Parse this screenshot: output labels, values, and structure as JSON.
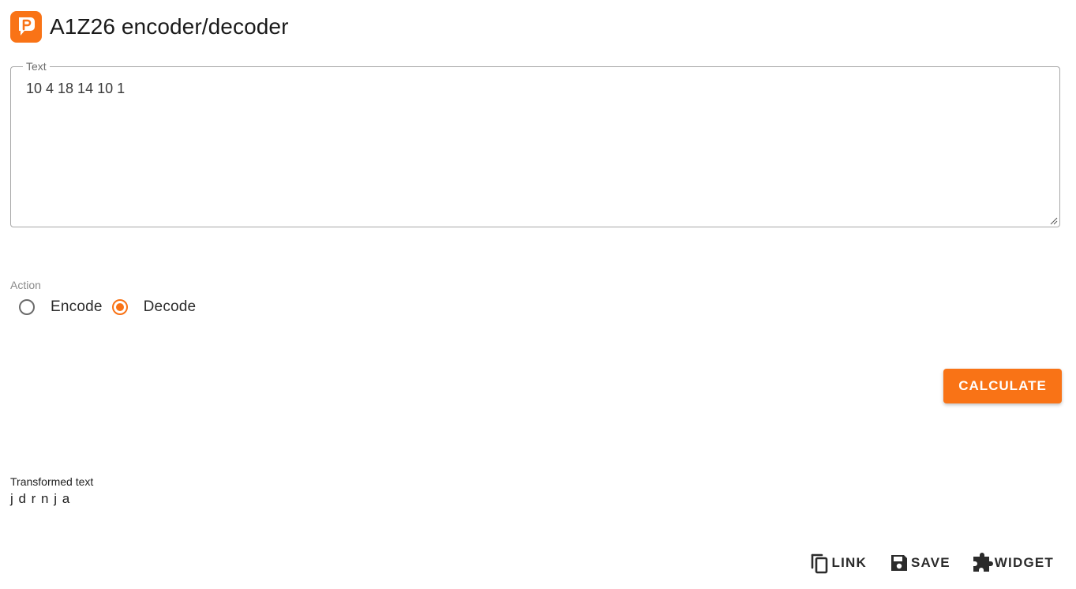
{
  "header": {
    "title": "A1Z26 encoder/decoder",
    "logo_icon": "planetcalc-logo-icon",
    "logo_color": "#f97316"
  },
  "text_field": {
    "label": "Text",
    "value": "10 4 18 14 10 1"
  },
  "action": {
    "label": "Action",
    "options": [
      {
        "label": "Encode",
        "checked": false
      },
      {
        "label": "Decode",
        "checked": true
      }
    ]
  },
  "calculate_button": {
    "label": "CALCULATE",
    "color": "#f97316"
  },
  "result": {
    "label": "Transformed text",
    "value": "j d r n j a"
  },
  "toolbar": {
    "link_label": "LINK",
    "link_icon": "copy-icon",
    "save_label": "SAVE",
    "save_icon": "floppy-disk-icon",
    "widget_label": "WIDGET",
    "widget_icon": "puzzle-piece-icon"
  }
}
